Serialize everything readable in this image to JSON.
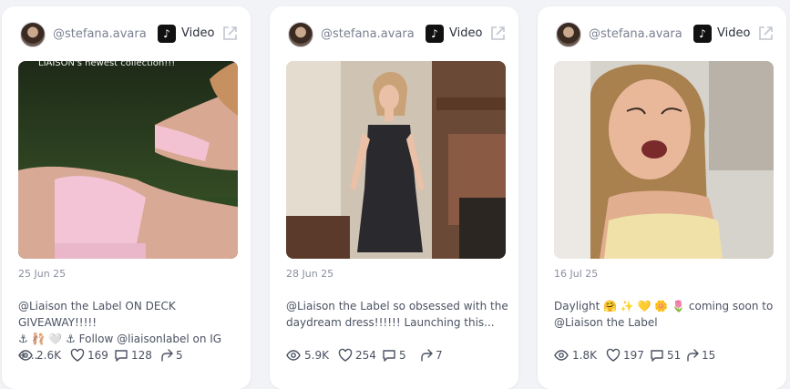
{
  "posts": [
    {
      "handle": "@stefana.avara",
      "type_label": "Video",
      "thumb_text": "LIAISON's newest collection!!!",
      "date": "25 Jun 25",
      "caption_line1": "@Liaison the Label ON DECK GIVEAWAY!!!!!",
      "caption_line2": "⚓ 🩰 🤍 ⚓ Follow @liaisonlabel on IG +...",
      "views": "2.6K",
      "likes": "169",
      "comments": "128",
      "shares": "5"
    },
    {
      "handle": "@stefana.avara",
      "type_label": "Video",
      "thumb_text": "",
      "date": "28 Jun 25",
      "caption_line1": "@Liaison the Label so obsessed with the",
      "caption_line2": "daydream dress!!!!!! Launching this...",
      "views": "5.9K",
      "likes": "254",
      "comments": "5",
      "shares": "7"
    },
    {
      "handle": "@stefana.avara",
      "type_label": "Video",
      "thumb_text": "",
      "date": "16 Jul 25",
      "caption_line1": "Daylight 🤗 ✨ 💛 🌼 🌷 coming soon to",
      "caption_line2": "@Liaison the Label",
      "views": "1.8K",
      "likes": "197",
      "comments": "51",
      "shares": "15"
    }
  ],
  "icons": {
    "platform": "tiktok-icon",
    "open": "external-link-icon",
    "views": "eye-icon",
    "likes": "heart-icon",
    "comments": "comment-icon",
    "shares": "share-icon"
  },
  "colors": {
    "background": "#f2f3f6",
    "card": "#ffffff",
    "text": "#4b5262",
    "muted": "#8a90a0"
  }
}
